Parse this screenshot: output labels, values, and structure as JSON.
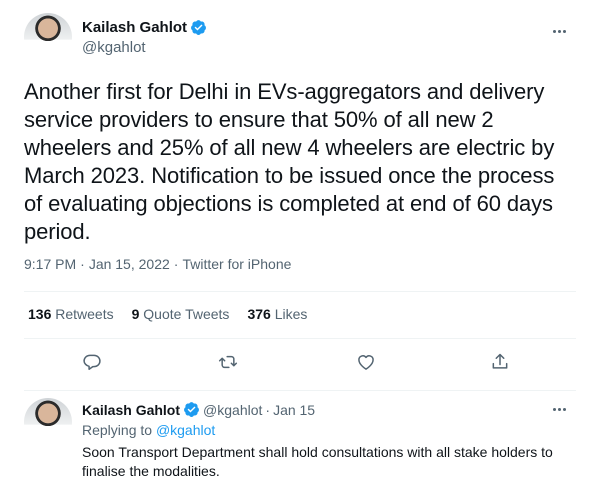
{
  "tweet": {
    "author_name": "Kailash Gahlot",
    "author_handle": "@kgahlot",
    "text": "Another first for Delhi in EVs-aggregators and delivery service providers to ensure that 50% of all new 2 wheelers and 25% of all new 4 wheelers are electric by March 2023. Notification to be issued once the process of evaluating objections is completed at end of 60 days period.",
    "time": "9:17 PM",
    "separator": "·",
    "date": "Jan 15, 2022",
    "source": "Twitter for iPhone"
  },
  "stats": {
    "retweets_count": "136",
    "retweets_label": "Retweets",
    "quotes_count": "9",
    "quotes_label": "Quote Tweets",
    "likes_count": "376",
    "likes_label": "Likes"
  },
  "actions": {
    "icons": [
      "reply-icon",
      "retweet-icon",
      "like-icon",
      "share-icon"
    ]
  },
  "reply": {
    "author_name": "Kailash Gahlot",
    "author_handle": "@kgahlot",
    "separator": "·",
    "date": "Jan 15",
    "replying_prefix": "Replying to",
    "replying_handle": "@kgahlot",
    "text": "Soon Transport Department shall hold consultations with all stake holders to finalise the modalities."
  },
  "colors": {
    "verified": "#1d9bf0",
    "link": "#1d9bf0",
    "muted": "#536471",
    "text": "#0f1419",
    "divider": "#eff3f4"
  }
}
